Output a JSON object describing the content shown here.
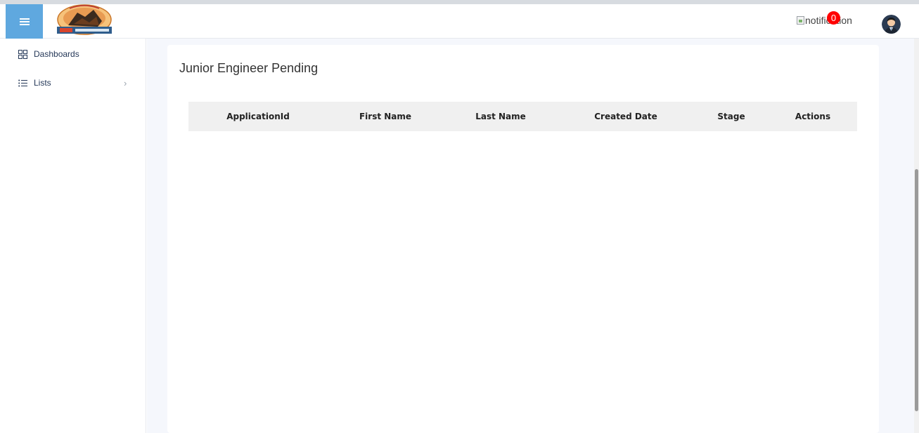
{
  "header": {
    "notification_alt": "notification",
    "notification_count": "0",
    "menu_icon": "hamburger-menu-icon",
    "avatar_icon": "user-avatar-icon"
  },
  "sidebar": {
    "items": [
      {
        "label": "Dashboards",
        "icon": "grid-icon"
      },
      {
        "label": "Lists",
        "icon": "list-icon",
        "expand_icon": "chevron-right-icon"
      }
    ]
  },
  "main": {
    "title": "Junior Engineer Pending",
    "table": {
      "columns": [
        "ApplicationId",
        "First Name",
        "Last Name",
        "Created Date",
        "Stage",
        "Actions"
      ],
      "rows": []
    }
  },
  "colors": {
    "menu_button": "#5fa8df",
    "badge": "#ff0000",
    "content_background": "#f5f7fc",
    "table_header": "#f0f0f0"
  }
}
